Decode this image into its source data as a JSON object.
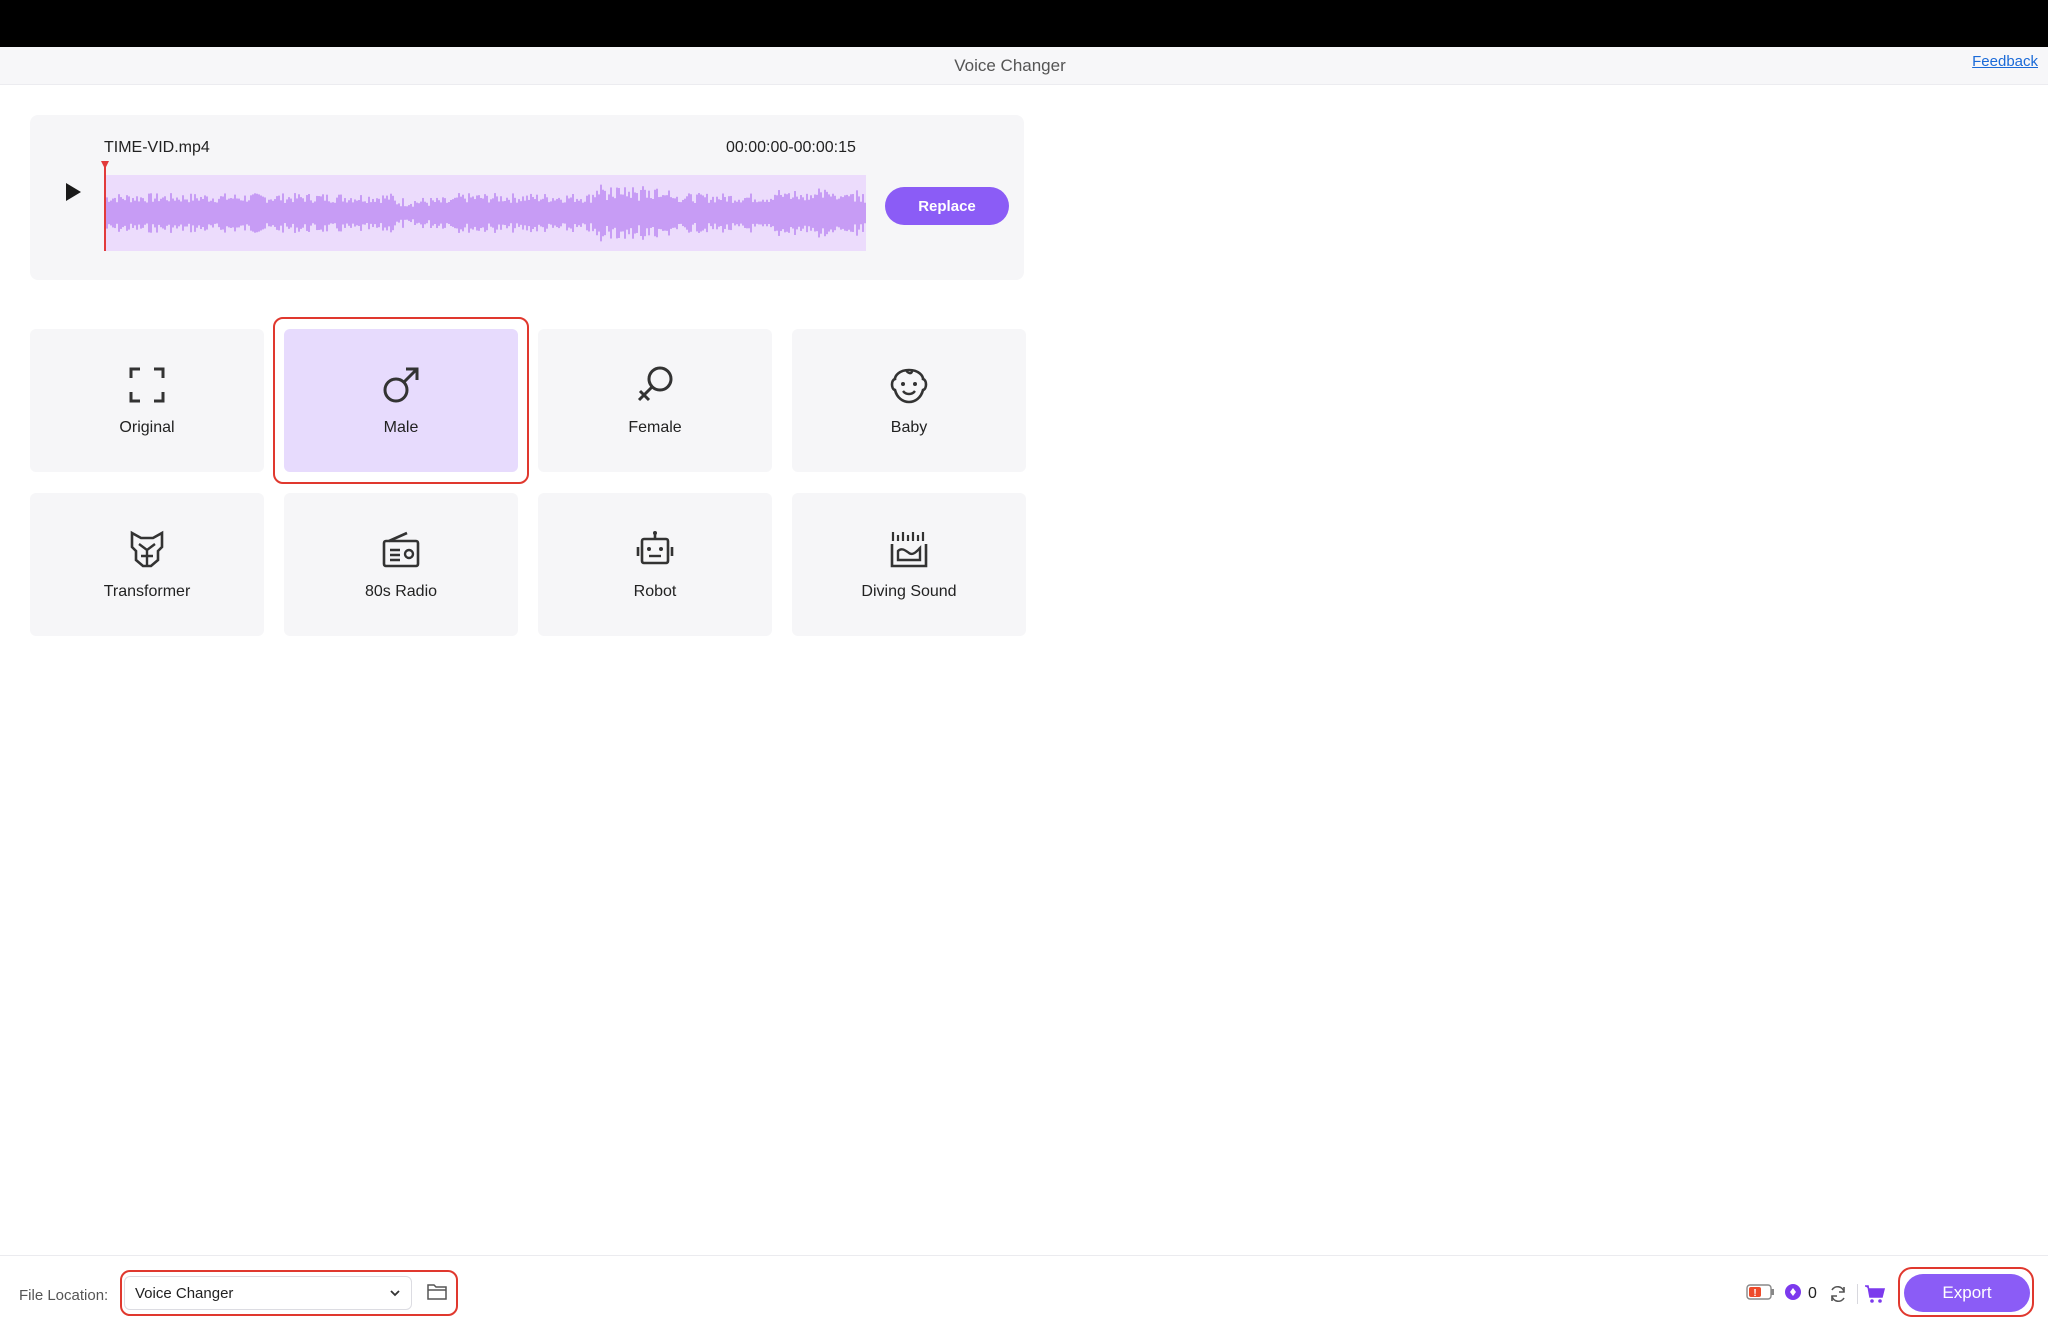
{
  "window": {
    "title": "Voice Changer",
    "feedback_label": "Feedback"
  },
  "audio": {
    "file_name": "TIME-VID.mp4",
    "time_range": "00:00:00-00:00:15",
    "replace_label": "Replace"
  },
  "effects": [
    {
      "label": "Original",
      "icon": "fullscreen-icon",
      "selected": false
    },
    {
      "label": "Male",
      "icon": "male-symbol-icon",
      "selected": true
    },
    {
      "label": "Female",
      "icon": "female-symbol-icon",
      "selected": false
    },
    {
      "label": "Baby",
      "icon": "baby-face-icon",
      "selected": false
    },
    {
      "label": "Transformer",
      "icon": "transformer-icon",
      "selected": false
    },
    {
      "label": "80s Radio",
      "icon": "radio-icon",
      "selected": false
    },
    {
      "label": "Robot",
      "icon": "robot-icon",
      "selected": false
    },
    {
      "label": "Diving Sound",
      "icon": "diving-sound-icon",
      "selected": false
    }
  ],
  "footer": {
    "file_location_label": "File Location:",
    "file_location_value": "Voice Changer",
    "credit_count": "0",
    "export_label": "Export"
  },
  "colors": {
    "accent": "#8b5cf6",
    "selected_card": "#e7dbfd",
    "waveform_bg": "#ecdcfc",
    "waveform_fill": "#c79cf5",
    "highlight": "#e0382e"
  }
}
